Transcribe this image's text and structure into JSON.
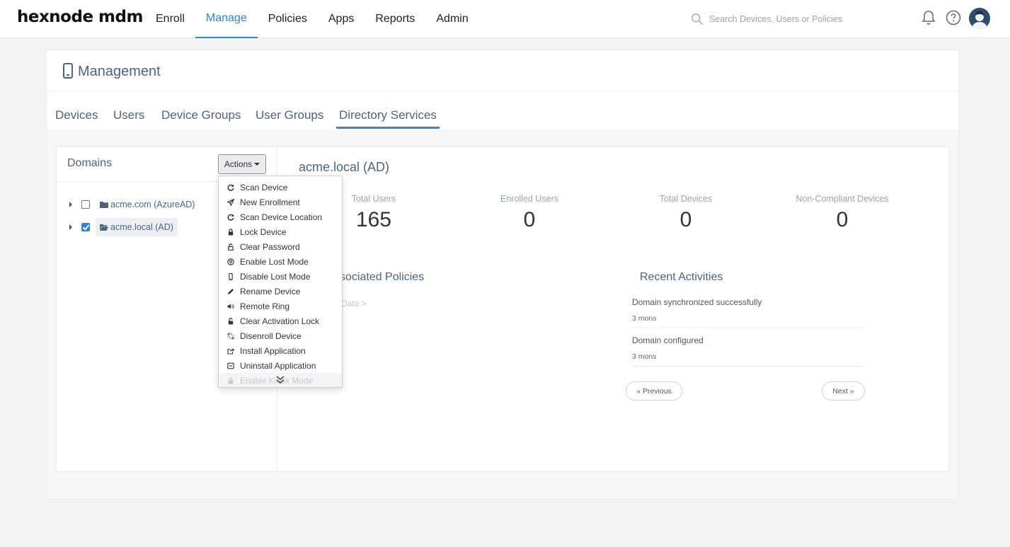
{
  "brand": {
    "logo": "hexnode mdm"
  },
  "nav": [
    {
      "label": "Enroll",
      "active": false
    },
    {
      "label": "Manage",
      "active": true
    },
    {
      "label": "Policies",
      "active": false
    },
    {
      "label": "Apps",
      "active": false
    },
    {
      "label": "Reports",
      "active": false
    },
    {
      "label": "Admin",
      "active": false
    }
  ],
  "search": {
    "placeholder": "Search Devices, Users or Policies"
  },
  "page": {
    "title": "Management"
  },
  "subtabs": [
    {
      "label": "Devices",
      "active": false
    },
    {
      "label": "Users",
      "active": false
    },
    {
      "label": "Device Groups",
      "active": false
    },
    {
      "label": "User Groups",
      "active": false
    },
    {
      "label": "Directory Services",
      "active": true
    }
  ],
  "domains": {
    "title": "Domains",
    "actions_label": "Actions",
    "items": [
      {
        "label": "acme.com (AzureAD)",
        "checked": false
      },
      {
        "label": "acme.local (AD)",
        "checked": true
      }
    ]
  },
  "actions_menu": [
    {
      "label": "Scan Device",
      "icon": "refresh-icon"
    },
    {
      "label": "New Enrollment",
      "icon": "send-icon"
    },
    {
      "label": "Scan Device Location",
      "icon": "refresh-icon"
    },
    {
      "label": "Lock Device",
      "icon": "lock-icon"
    },
    {
      "label": "Clear Password",
      "icon": "unlock-icon"
    },
    {
      "label": "Enable Lost Mode",
      "icon": "lost-mode-icon"
    },
    {
      "label": "Disable Lost Mode",
      "icon": "mobile-icon"
    },
    {
      "label": "Rename Device",
      "icon": "pencil-icon"
    },
    {
      "label": "Remote Ring",
      "icon": "volume-icon"
    },
    {
      "label": "Clear Activation Lock",
      "icon": "unlock-icon"
    },
    {
      "label": "Disenroll Device",
      "icon": "unlink-icon"
    },
    {
      "label": "Install Application",
      "icon": "share-icon"
    },
    {
      "label": "Uninstall Application",
      "icon": "minus-box-icon"
    },
    {
      "label": "Enable Kiosk Mode",
      "icon": "lock-icon"
    }
  ],
  "detail": {
    "title": "acme.local (AD)",
    "stats": [
      {
        "label": "Total Users",
        "value": "165"
      },
      {
        "label": "Enrolled Users",
        "value": "0"
      },
      {
        "label": "Total Devices",
        "value": "0"
      },
      {
        "label": "Non-Compliant Devices",
        "value": "0"
      }
    ],
    "associated_policies_title": "ssociated Policies",
    "no_data": "Data >",
    "recent_title": "Recent Activities",
    "activities": [
      {
        "text": "Domain synchronized successfully",
        "time": "3 mons"
      },
      {
        "text": "Domain configured",
        "time": "3 mons"
      }
    ],
    "previous_label": "« Previous",
    "next_label": "Next »"
  }
}
